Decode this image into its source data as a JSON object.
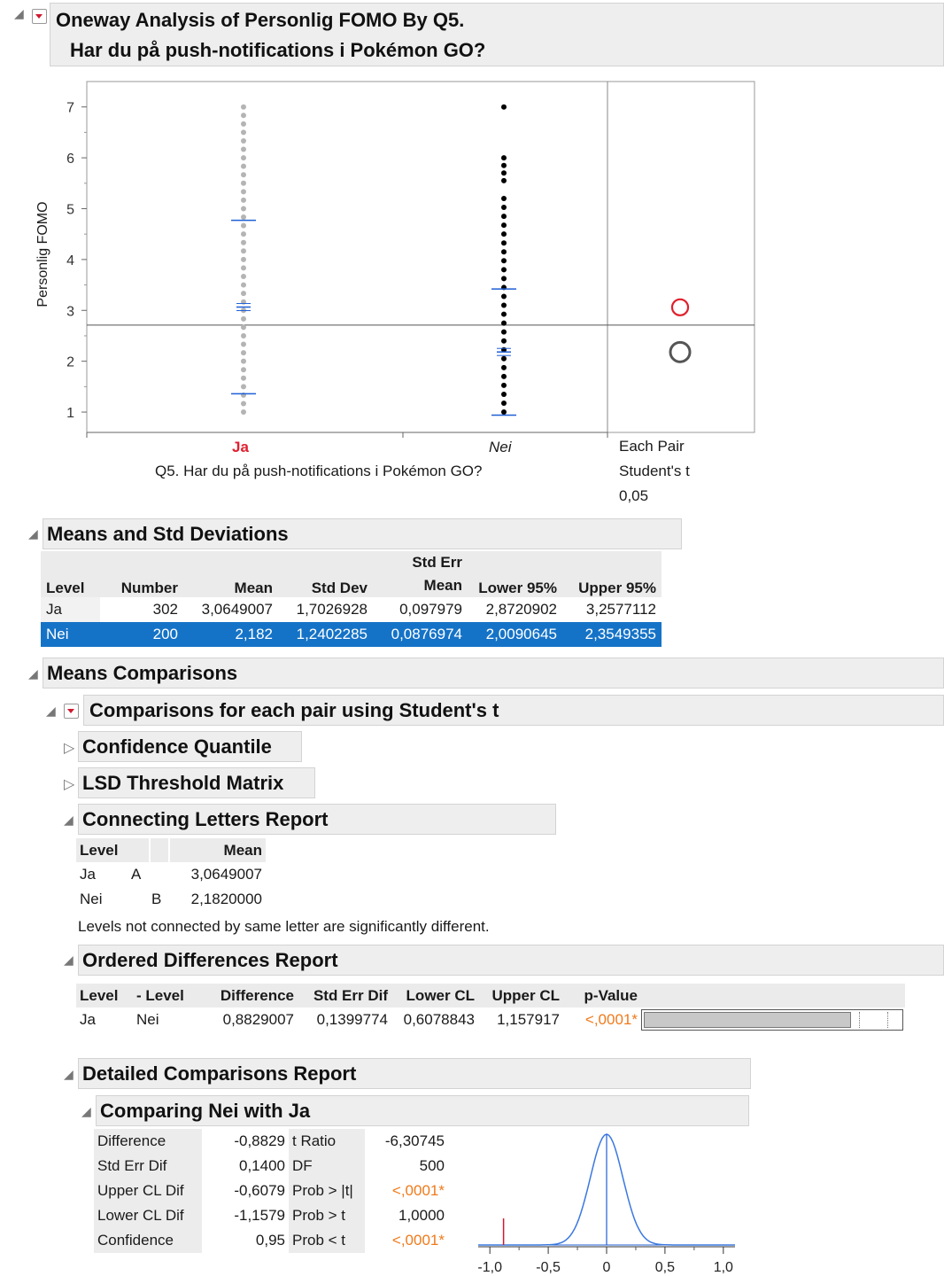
{
  "title": {
    "line1": "Oneway Analysis of Personlig FOMO By Q5.",
    "line2": "Har du på push-notifications i Pokémon GO?"
  },
  "plot": {
    "y_axis_label": "Personlig FOMO",
    "y_ticks": [
      "1",
      "2",
      "3",
      "4",
      "5",
      "6",
      "7"
    ],
    "x_label": "Q5. Har du på push-notifications i Pokémon GO?",
    "x_categories": [
      "Ja",
      "Nei"
    ],
    "compare_label": [
      "Each Pair",
      "Student's t",
      "0,05"
    ],
    "colors": {
      "ja_points": "#b4b4b4",
      "nei_points": "#000000",
      "mean_lines": "#1f5fd6",
      "circle_red": "#e0202c",
      "circle_gray": "#555555",
      "ja_label": "#e02030"
    }
  },
  "chart_data": {
    "type": "scatter",
    "title": "",
    "xlabel": "Q5. Har du på push-notifications i Pokémon GO?",
    "ylabel": "Personlig FOMO",
    "ylim": [
      0.6,
      7.5
    ],
    "categories": [
      "Ja",
      "Nei"
    ],
    "series": [
      {
        "name": "Ja",
        "y_range": [
          1,
          7
        ],
        "mean": 3.0649007,
        "mean_plus_sd": 4.77,
        "mean_minus_sd": 1.36
      },
      {
        "name": "Nei",
        "y_range": [
          1,
          7
        ],
        "mean": 2.182,
        "mean_plus_sd": 3.42,
        "mean_minus_sd": 0.94
      }
    ],
    "grand_mean": 2.71,
    "comparison_circles": [
      {
        "center": 3.06,
        "color": "red"
      },
      {
        "center": 2.18,
        "color": "gray"
      }
    ]
  },
  "means_std": {
    "header": "Means and Std Deviations",
    "columns": [
      "Level",
      "Number",
      "Mean",
      "Std Dev",
      "Std Err\nMean",
      "Lower 95%",
      "Upper 95%"
    ],
    "col_stderr_top": "Std Err",
    "col_stderr_bottom": "Mean",
    "rows": [
      [
        "Ja",
        "302",
        "3,0649007",
        "1,7026928",
        "0,097979",
        "2,8720902",
        "3,2577112"
      ],
      [
        "Nei",
        "200",
        "2,182",
        "1,2402285",
        "0,0876974",
        "2,0090645",
        "2,3549355"
      ]
    ]
  },
  "means_comparisons": {
    "header": "Means Comparisons",
    "sub_header": "Comparisons for each pair using Student's t",
    "confidence_quantile": "Confidence Quantile",
    "lsd_matrix": "LSD Threshold Matrix",
    "connecting": {
      "header": "Connecting Letters Report",
      "col_level": "Level",
      "col_mean": "Mean",
      "rows": [
        {
          "level": "Ja",
          "a": "A",
          "b": "",
          "mean": "3,0649007"
        },
        {
          "level": "Nei",
          "a": "",
          "b": "B",
          "mean": "2,1820000"
        }
      ],
      "note": "Levels not connected by same letter are significantly different."
    },
    "ordered": {
      "header": "Ordered Differences Report",
      "columns": [
        "Level",
        "- Level",
        "Difference",
        "Std Err Dif",
        "Lower CL",
        "Upper CL",
        "p-Value"
      ],
      "row": [
        "Ja",
        "Nei",
        "0,8829007",
        "0,1399774",
        "0,6078843",
        "1,157917",
        "<,0001*"
      ],
      "bar_fraction": 0.8
    },
    "detailed": {
      "header": "Detailed Comparisons Report",
      "sub_header": "Comparing Nei with Ja",
      "left_labels": [
        "Difference",
        "Std Err Dif",
        "Upper CL Dif",
        "Lower CL Dif",
        "Confidence"
      ],
      "left_values": [
        "-0,8829",
        "0,1400",
        "-0,6079",
        "-1,1579",
        "0,95"
      ],
      "right_labels": [
        "t Ratio",
        "DF",
        "Prob > |t|",
        "Prob > t",
        "Prob < t"
      ],
      "right_values": [
        "-6,30745",
        "500",
        "<,0001*",
        "1,0000",
        "<,0001*"
      ],
      "axis_ticks": [
        "-1,0",
        "-0,5",
        "0",
        "0,5",
        "1,0"
      ],
      "observed_difference": -0.8829,
      "std_err": 0.14
    }
  }
}
